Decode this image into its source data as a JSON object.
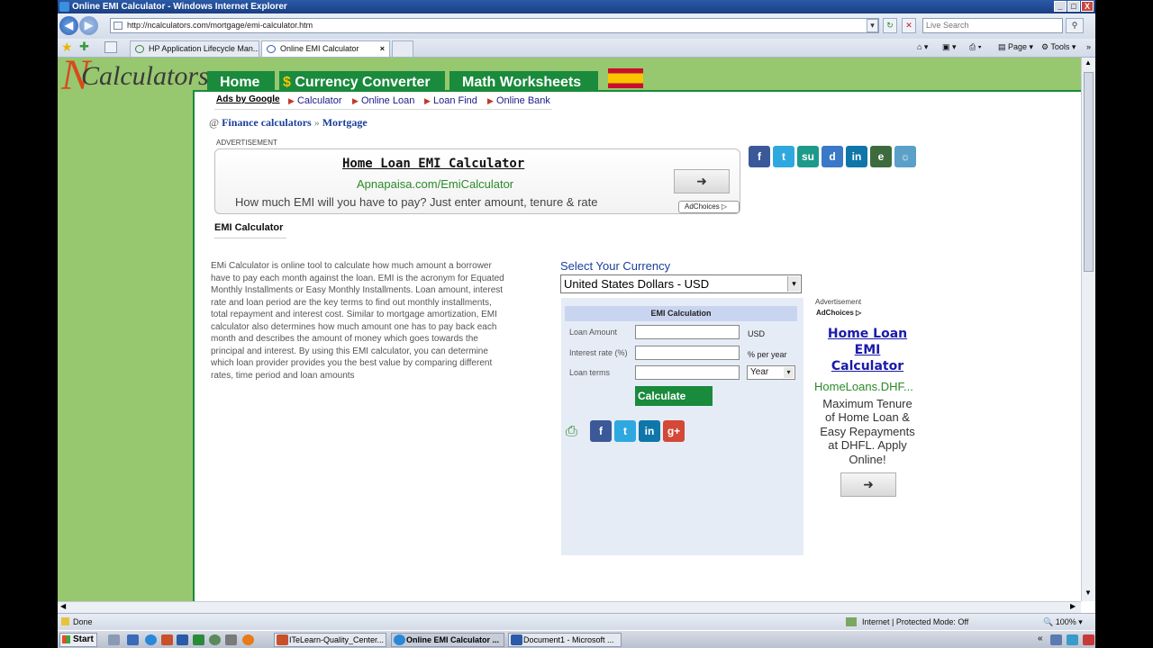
{
  "window": {
    "title": "Online EMI Calculator - Windows Internet Explorer",
    "minimize": "_",
    "maximize": "□",
    "close": "X"
  },
  "addressbar": {
    "url": "http://ncalculators.com/mortgage/emi-calculator.htm",
    "search_placeholder": "Live Search"
  },
  "tabs": [
    {
      "label": "HP Application Lifecycle Man..."
    },
    {
      "label": "Online EMI Calculator"
    }
  ],
  "commandbar": {
    "page": "Page",
    "tools": "Tools"
  },
  "site": {
    "logo_n": "N",
    "logo_rest": "Calculators",
    "nav": [
      "Home",
      "Currency Converter",
      "Math Worksheets"
    ],
    "currency_symbol": "$",
    "ads_by_google": "Ads by Google",
    "subnav": [
      "Calculator",
      "Online Loan",
      "Loan Find",
      "Online Bank"
    ],
    "breadcrumb": {
      "at": "@",
      "first": "Finance calculators",
      "sep": "»",
      "second": "Mortgage"
    },
    "advertisement_label": "ADVERTISEMENT",
    "ad1": {
      "title": "Home Loan EMI Calculator",
      "url": "Apnapaisa.com/EmiCalculator",
      "text": "How much EMI will you have to pay? Just enter amount, tenure & rate",
      "adchoices": "AdChoices"
    },
    "section_title": "EMI Calculator",
    "description_lines": [
      "EMi Calculator is online tool to calculate how much amount a borrower",
      "have to pay each month against the loan. EMI is the acronym for Equated",
      "Monthly Installments or Easy Monthly Installments. Loan amount, interest",
      "rate and loan period are the key terms to find out monthly installments,",
      "total repayment and interest cost. Similar to mortgage amortization, EMI",
      "calculator also determines how much amount one has to pay back each",
      "month and describes the amount of money which goes towards the",
      "principal and interest. By using this EMI calculator, you can determine",
      "which loan provider provides you the best value by comparing different",
      "rates, time period and loan amounts"
    ],
    "currency": {
      "label": "Select Your Currency",
      "selected": "United States Dollars - USD"
    },
    "emi_form": {
      "header": "EMI Calculation",
      "loan_amount_label": "Loan Amount",
      "loan_amount_unit": "USD",
      "interest_label": "Interest rate (%)",
      "interest_unit": "% per year",
      "terms_label": "Loan terms",
      "terms_unit": "Year",
      "calculate": "Calculate"
    },
    "ad2": {
      "advertisement": "Advertisement",
      "adchoices": "AdChoices",
      "title_lines": [
        "Home Loan",
        "EMI",
        "Calculator"
      ],
      "url": "HomeLoans.DHF...",
      "text_lines": [
        "Maximum Tenure",
        "of Home Loan &",
        "Easy Repayments",
        "at DHFL. Apply",
        "Online!"
      ]
    },
    "share_icons": [
      "facebook-icon",
      "twitter-icon",
      "stumbleupon-icon",
      "delicious-icon",
      "linkedin-icon",
      "evernote-icon",
      "other-icon"
    ]
  },
  "status": {
    "left": "Done",
    "zone": "Internet | Protected Mode: Off",
    "zoom": "100%"
  },
  "taskbar": {
    "start": "Start",
    "buttons": [
      "ITeLearn-Quality_Center...",
      "Online EMI Calculator ...",
      "Document1 - Microsoft ..."
    ],
    "tray": "«"
  },
  "colors": {
    "green": "#1a8a3c",
    "page_bg": "#97c76f",
    "link_blue": "#1a3e9a"
  }
}
